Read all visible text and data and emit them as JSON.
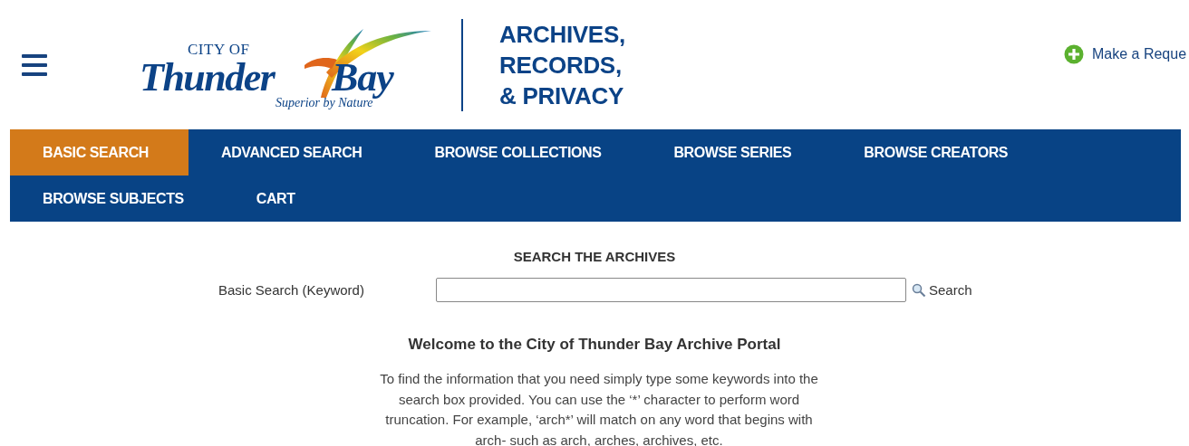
{
  "header": {
    "logo": {
      "city_of": "CITY OF",
      "thunder": "Thunder",
      "bay": "Bay",
      "tagline": "Superior by Nature"
    },
    "department": [
      "ARCHIVES,",
      "RECORDS,",
      "& PRIVACY"
    ],
    "request_link": "Make a Reque"
  },
  "nav": {
    "tabs": [
      {
        "label": "BASIC SEARCH",
        "selected": true
      },
      {
        "label": "ADVANCED SEARCH",
        "selected": false
      },
      {
        "label": "BROWSE COLLECTIONS",
        "selected": false
      },
      {
        "label": "BROWSE SERIES",
        "selected": false
      },
      {
        "label": "BROWSE CREATORS",
        "selected": false
      },
      {
        "label": "BROWSE SUBJECTS",
        "selected": false
      },
      {
        "label": "CART",
        "selected": false
      }
    ]
  },
  "search": {
    "title": "SEARCH THE ARCHIVES",
    "label": "Basic Search (Keyword)",
    "button": "Search"
  },
  "welcome": {
    "heading": "Welcome to the City of Thunder Bay Archive Portal",
    "text": "To find the information that you need simply type some keywords into the search box provided. You can use the ‘*’ character to perform word truncation. For example, ‘arch*’ will match on any word that begins with arch- such as arch, arches, archives, etc."
  }
}
